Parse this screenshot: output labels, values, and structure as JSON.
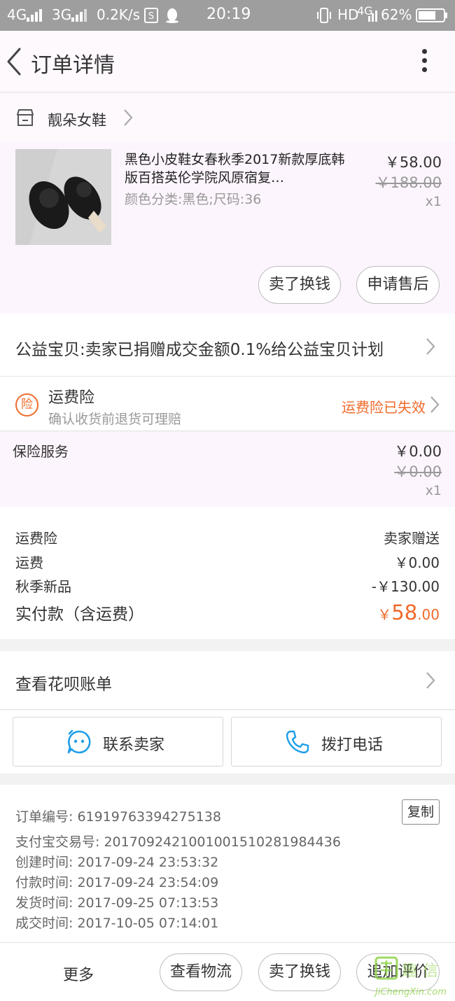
{
  "status_bar": {
    "network_left": "4G",
    "network_mid": "3G",
    "speed": "0.2K/s",
    "time": "20:19",
    "hd": "HD",
    "network_right": "4G",
    "battery": "62%"
  },
  "header": {
    "title": "订单详情"
  },
  "shop": {
    "name": "靓朵女鞋"
  },
  "product": {
    "title": "黑色小皮鞋女春秋季2017新款厚底韩版百搭英伦学院风原宿复…",
    "sku": "颜色分类:黑色;尺码:36",
    "price": "￥58.00",
    "original_price": "￥188.00",
    "quantity": "x1",
    "actions": [
      "卖了换钱",
      "申请售后"
    ]
  },
  "charity": {
    "text": "公益宝贝:卖家已捐赠成交金额0.1%给公益宝贝计划"
  },
  "freight_insurance": {
    "badge": "险",
    "title": "运费险",
    "subtitle": "确认收货前退货可理赔",
    "status": "运费险已失效"
  },
  "insurance_service": {
    "label": "保险服务",
    "price": "￥0.00",
    "original_price": "￥0.00",
    "quantity": "x1"
  },
  "summary": {
    "rows": [
      {
        "label": "运费险",
        "value": "卖家赠送"
      },
      {
        "label": "运费",
        "value": "￥0.00"
      },
      {
        "label": "秋季新品",
        "value": "-￥130.00"
      }
    ],
    "total_label": "实付款（含运费）",
    "total_currency": "￥",
    "total_integer": "58",
    "total_decimal": ".00"
  },
  "huabei": {
    "label": "查看花呗账单"
  },
  "contact": {
    "seller_label": "联系卖家",
    "call_label": "拨打电话"
  },
  "order_info": {
    "order_no": "订单编号: 61919763394275138",
    "copy_label": "复制",
    "alipay_no": "支付宝交易号: 2017092421001001510281984436",
    "created": "创建时间: 2017-09-24 23:53:32",
    "paid": "付款时间: 2017-09-24 23:54:09",
    "shipped": "发货时间: 2017-09-25 07:13:53",
    "completed": "成交时间: 2017-10-05 07:14:01"
  },
  "bottom_bar": {
    "more_label": "更多",
    "logistics_label": "查看物流",
    "sell_label": "卖了换钱",
    "review_label": "追加评价"
  },
  "watermark": {
    "domain": "JiChengXin.com"
  },
  "colors": {
    "accent": "#f06a2a",
    "icon_blue": "#1e9ee8",
    "status_bar": "#9e9e9e"
  }
}
